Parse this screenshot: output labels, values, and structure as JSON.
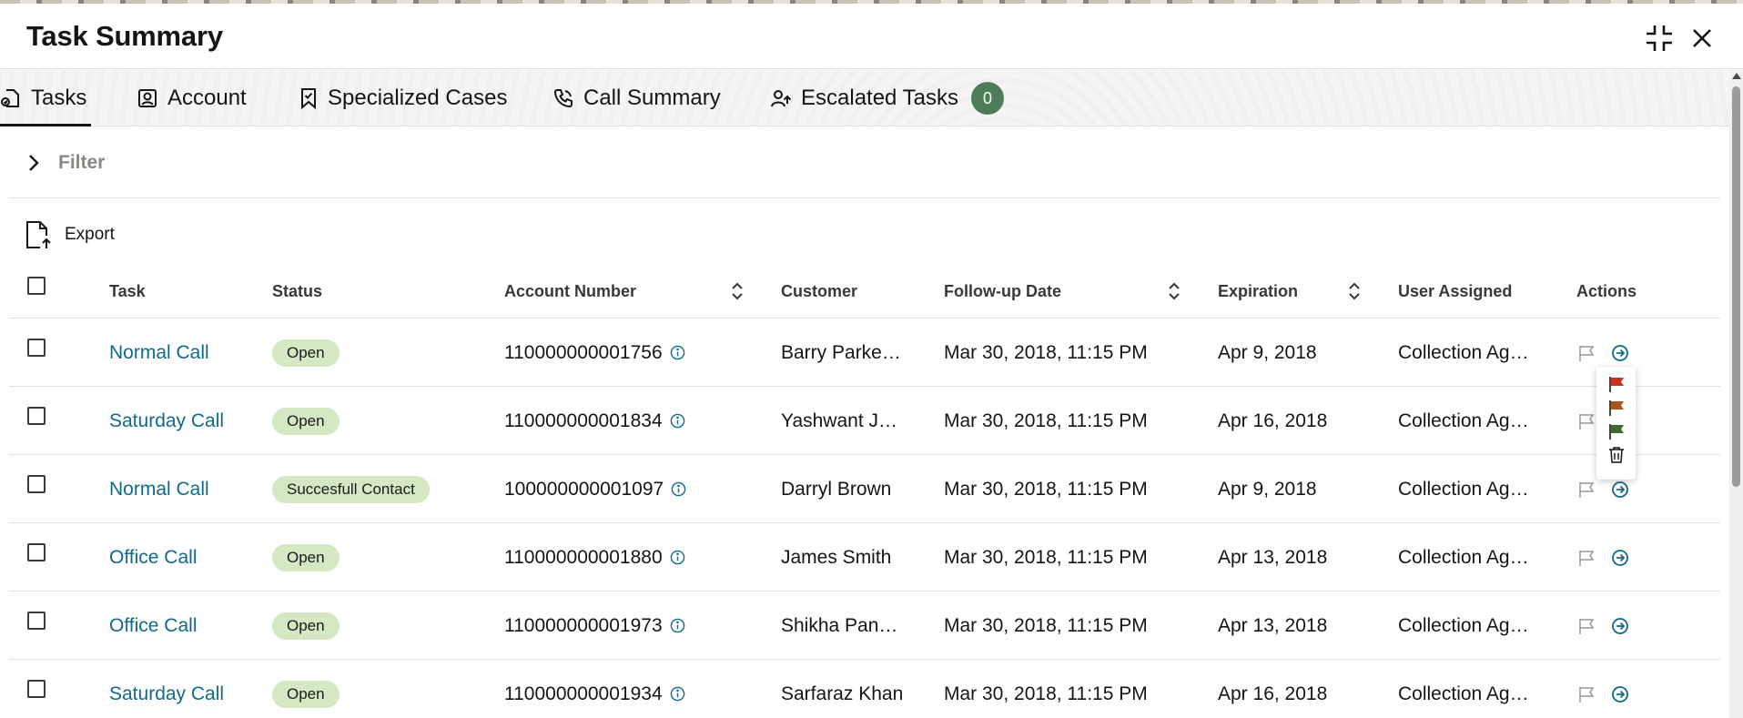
{
  "header": {
    "title": "Task Summary"
  },
  "tabs": [
    {
      "label": "Tasks",
      "icon": "tasks-icon"
    },
    {
      "label": "Account",
      "icon": "account-icon"
    },
    {
      "label": "Specialized Cases",
      "icon": "bookmark-icon"
    },
    {
      "label": "Call Summary",
      "icon": "phone-icon"
    },
    {
      "label": "Escalated Tasks",
      "icon": "user-escalate-icon",
      "badge": "0"
    }
  ],
  "filter": {
    "label": "Filter"
  },
  "toolbar": {
    "export_label": "Export"
  },
  "table": {
    "columns": [
      "Task",
      "Status",
      "Account Number",
      "Customer",
      "Follow-up Date",
      "Expiration",
      "User Assigned",
      "Actions"
    ],
    "rows": [
      {
        "task": "Normal Call",
        "status": "Open",
        "account": "110000000001756",
        "customer": "Barry Parke…",
        "followup": "Mar 30, 2018, 11:15 PM",
        "expiration": "Apr 9, 2018",
        "user": "Collection Ag…"
      },
      {
        "task": "Saturday Call",
        "status": "Open",
        "account": "110000000001834",
        "customer": "Yashwant J…",
        "followup": "Mar 30, 2018, 11:15 PM",
        "expiration": "Apr 16, 2018",
        "user": "Collection Ag…"
      },
      {
        "task": "Normal Call",
        "status": "Succesfull Contact",
        "account": "100000000001097",
        "customer": "Darryl Brown",
        "followup": "Mar 30, 2018, 11:15 PM",
        "expiration": "Apr 9, 2018",
        "user": "Collection Ag…"
      },
      {
        "task": "Office Call",
        "status": "Open",
        "account": "110000000001880",
        "customer": "James Smith",
        "followup": "Mar 30, 2018, 11:15 PM",
        "expiration": "Apr 13, 2018",
        "user": "Collection Ag…"
      },
      {
        "task": "Office Call",
        "status": "Open",
        "account": "110000000001973",
        "customer": "Shikha Pan…",
        "followup": "Mar 30, 2018, 11:15 PM",
        "expiration": "Apr 13, 2018",
        "user": "Collection Ag…"
      },
      {
        "task": "Saturday Call",
        "status": "Open",
        "account": "110000000001934",
        "customer": "Sarfaraz Khan",
        "followup": "Mar 30, 2018, 11:15 PM",
        "expiration": "Apr 16, 2018",
        "user": "Collection Ag…"
      }
    ]
  },
  "flag_menu": {
    "items": [
      "flag-red-icon",
      "flag-orange-icon",
      "flag-green-icon",
      "clear-flag-icon"
    ],
    "colors": {
      "red": "#c8321e",
      "orange": "#a8581a",
      "green": "#3e6b2e"
    }
  },
  "colors": {
    "link": "#0f6a8b",
    "pill_bg": "#d4e8c4",
    "badge_bg": "#4d7d58"
  }
}
